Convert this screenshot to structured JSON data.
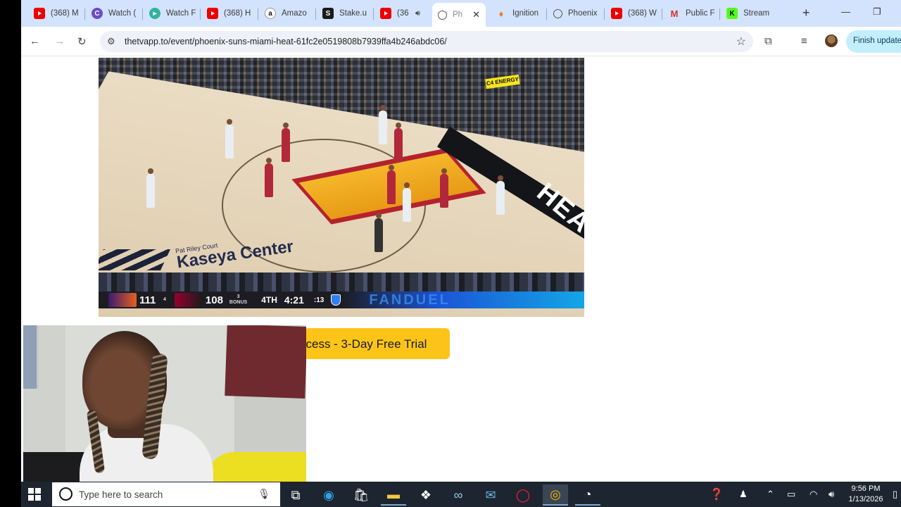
{
  "browser": {
    "tabs": [
      {
        "title": "(368) M",
        "icon": "youtube-icon",
        "color": "#e00000"
      },
      {
        "title": "Watch (",
        "icon": "site-icon",
        "color": "#6a4cc8"
      },
      {
        "title": "Watch F",
        "icon": "site-icon",
        "color": "#2fb39a"
      },
      {
        "title": "(368) H",
        "icon": "youtube-icon",
        "color": "#e00000"
      },
      {
        "title": "Amazo",
        "icon": "amazon-icon",
        "color": "#333333"
      },
      {
        "title": "Stake.u",
        "icon": "stake-icon",
        "color": "#1b1b1b"
      },
      {
        "title": "(36",
        "icon": "youtube-icon",
        "color": "#e00000"
      },
      {
        "title": "Ph",
        "icon": "globe-icon",
        "color": "#555555"
      },
      {
        "title": "Ignition",
        "icon": "ignition-icon",
        "color": "#f07a22"
      },
      {
        "title": "Phoenix",
        "icon": "globe-icon",
        "color": "#555555"
      },
      {
        "title": "(368) W",
        "icon": "youtube-icon",
        "color": "#e00000"
      },
      {
        "title": "Public F",
        "icon": "gmail-icon",
        "color": "#d93025"
      },
      {
        "title": "Stream",
        "icon": "kick-icon",
        "color": "#53fc18"
      }
    ],
    "url": "thetvapp.to/event/phoenix-suns-miami-heat-61fc2e0519808b7939ffa4b246abdc06/",
    "update_label": "Finish update"
  },
  "page": {
    "trial_button": "ccess - 3-Day Free Trial",
    "banner": "C4 ENERGY",
    "floor_small": "Pat Riley Court",
    "floor_logo": "Kaseya Center",
    "baseline_text": "HEAT"
  },
  "scoreboard": {
    "away_score": "111",
    "away_timeouts": "4",
    "home_score": "108",
    "home_timeouts": "3",
    "home_note": "BONUS",
    "period": "4TH",
    "clock": "4:21",
    "shot_clock": ":13",
    "sponsor": "FANDUEL",
    "away_color": "#3a1a6e",
    "home_color": "#98002e"
  },
  "taskbar": {
    "search_placeholder": "Type here to search",
    "time": "9:56 PM",
    "date": "1/13/2026"
  }
}
